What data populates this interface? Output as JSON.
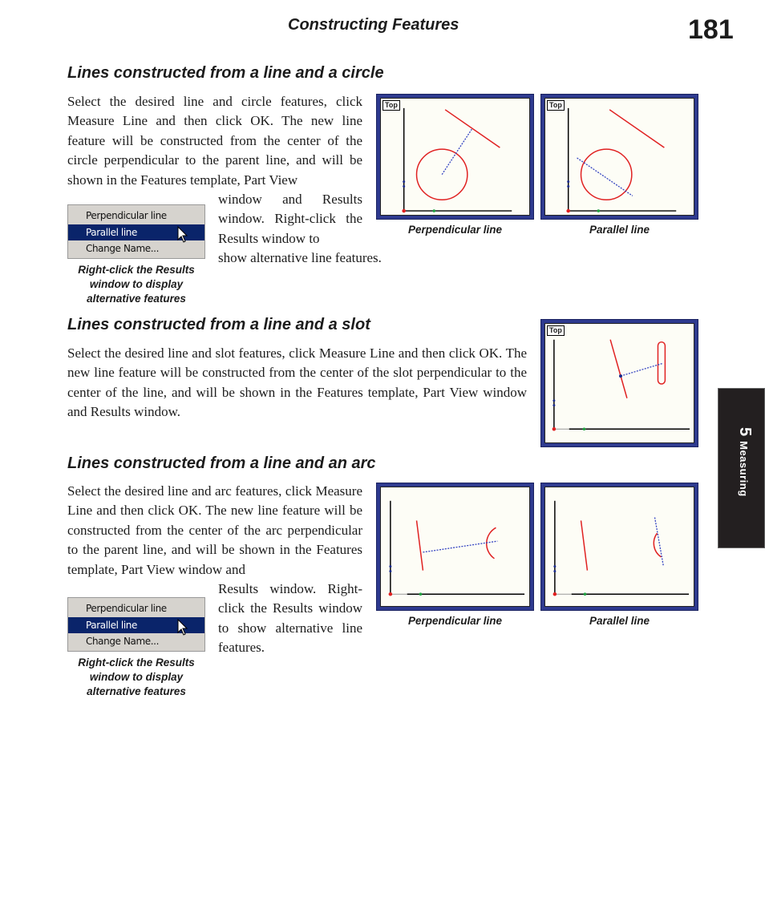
{
  "header": {
    "running_title": "Constructing Features",
    "page_number": "181"
  },
  "chapter_tab": {
    "number": "5",
    "label": "Measuring"
  },
  "colors": {
    "frame_blue": "#2e3a8f",
    "feature_red": "#e02020",
    "construct_blue": "#3040c0",
    "menu_highlight": "#0a246a",
    "tab_bg": "#231f20"
  },
  "sections": [
    {
      "heading": "Lines constructed from a line and a circle",
      "body_top": "Select the desired line and circle features, click Measure Line and then click OK.  The new line feature will be constructed from the center of the circle perpendicular to the parent line, and will be shown in the Features template, Part View",
      "body_side": "window and Results window.  Right-click the Results window to",
      "body_last": "show alternative line features.",
      "menu": {
        "items": [
          "Perpendicular line",
          "Parallel line",
          "Change Name..."
        ],
        "selected_index": 1
      },
      "menu_caption": [
        "Right-click the Results",
        "window to display",
        "alternative features"
      ],
      "figures": [
        {
          "view_label": "Top",
          "caption": "Perpendicular line"
        },
        {
          "view_label": "Top",
          "caption": "Parallel line"
        }
      ]
    },
    {
      "heading": "Lines constructed from a line and a slot",
      "body": "Select the desired line and slot features, click Measure Line and then click OK.  The new line feature will be constructed from the center of the slot perpendicular to the center of the line, and will be shown in the Features template, Part View window and Results window.",
      "figure": {
        "view_label": "Top"
      }
    },
    {
      "heading": "Lines constructed from a line and an arc",
      "body_top": "Select the desired line and arc features, click Measure Line and then click OK.  The new line feature will be constructed from the center of the arc perpendicular to the parent line, and will be shown in the Features template, Part View window and",
      "body_side": "Results window. Right-click the Results window to show alternative line features.",
      "menu": {
        "items": [
          "Perpendicular line",
          "Parallel line",
          "Change Name..."
        ],
        "selected_index": 1
      },
      "menu_caption": [
        "Right-click the Results",
        "window to display",
        "alternative features"
      ],
      "figures": [
        {
          "caption": "Perpendicular line"
        },
        {
          "caption": "Parallel line"
        }
      ]
    }
  ]
}
